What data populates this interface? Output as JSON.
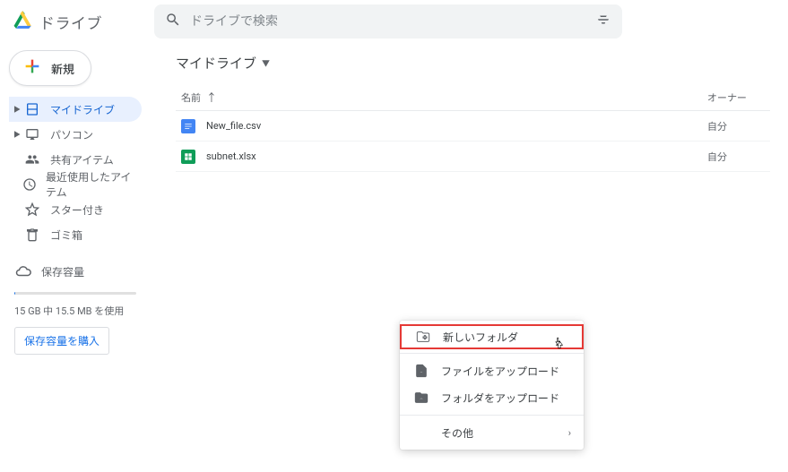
{
  "app": {
    "title": "ドライブ"
  },
  "search": {
    "placeholder": "ドライブで検索"
  },
  "sidebar": {
    "new_label": "新規",
    "items": [
      {
        "label": "マイドライブ",
        "active": true,
        "expandable": true
      },
      {
        "label": "パソコン",
        "active": false,
        "expandable": true
      },
      {
        "label": "共有アイテム",
        "active": false,
        "expandable": false
      },
      {
        "label": "最近使用したアイテム",
        "active": false,
        "expandable": false
      },
      {
        "label": "スター付き",
        "active": false,
        "expandable": false
      },
      {
        "label": "ゴミ箱",
        "active": false,
        "expandable": false
      }
    ],
    "storage": {
      "label": "保存容量",
      "used_text": "15 GB 中 15.5 MB を使用",
      "buy_label": "保存容量を購入"
    }
  },
  "breadcrumb": {
    "label": "マイドライブ"
  },
  "columns": {
    "name": "名前",
    "owner": "オーナー"
  },
  "files": [
    {
      "name": "New_file.csv",
      "owner": "自分",
      "type": "doc"
    },
    {
      "name": "subnet.xlsx",
      "owner": "自分",
      "type": "sheet"
    }
  ],
  "context_menu": {
    "new_folder": "新しいフォルダ",
    "upload_file": "ファイルをアップロード",
    "upload_folder": "フォルダをアップロード",
    "more": "その他"
  }
}
